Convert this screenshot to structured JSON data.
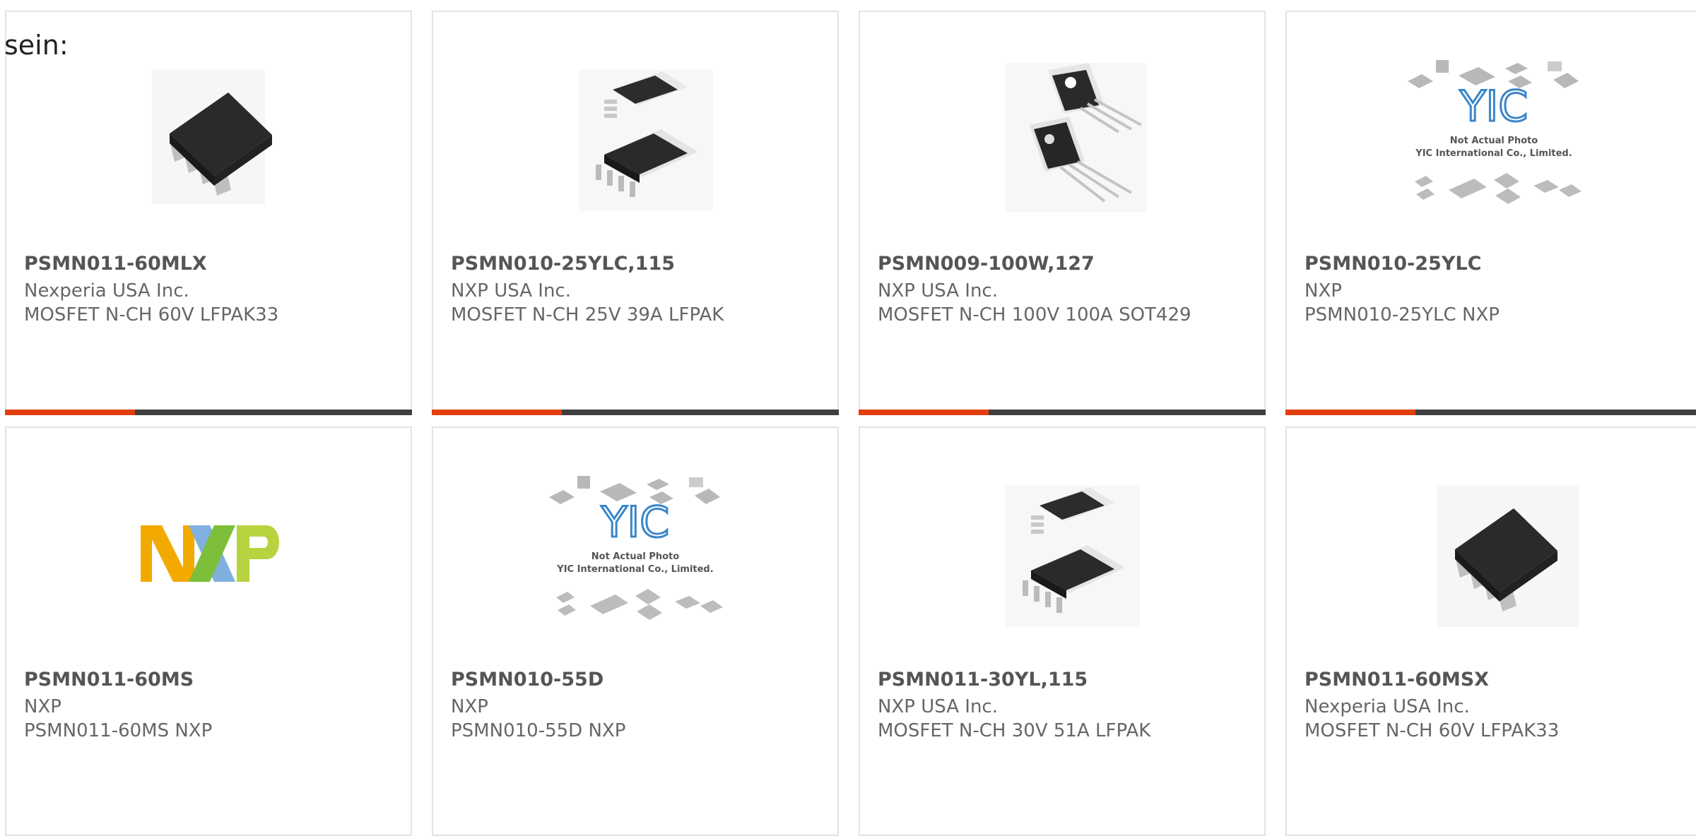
{
  "page": {
    "heading": "sein:"
  },
  "theme": {
    "accent_color": "#e23e0e",
    "bar_color": "#3f3f3f",
    "border_color": "#e3e3e3"
  },
  "products": [
    {
      "part_number": "PSMN011-60MLX",
      "manufacturer": "Nexperia USA Inc.",
      "description": "MOSFET N-CH 60V LFPAK33",
      "image": "lfpak33-package"
    },
    {
      "part_number": "PSMN010-25YLC,115",
      "manufacturer": "NXP USA Inc.",
      "description": "MOSFET N-CH 25V 39A LFPAK",
      "image": "lfpak-package"
    },
    {
      "part_number": "PSMN009-100W,127",
      "manufacturer": "NXP USA Inc.",
      "description": "MOSFET N-CH 100V 100A SOT429",
      "image": "to247-package"
    },
    {
      "part_number": "PSMN010-25YLC",
      "manufacturer": "NXP",
      "description": "PSMN010-25YLC NXP",
      "image": "yic-placeholder",
      "placeholder_line1": "Not Actual Photo",
      "placeholder_line2": "YIC International Co., Limited."
    },
    {
      "part_number": "PSMN011-60MS",
      "manufacturer": "NXP",
      "description": "PSMN011-60MS NXP",
      "image": "nxp-logo",
      "logo_text": "NXP"
    },
    {
      "part_number": "PSMN010-55D",
      "manufacturer": "NXP",
      "description": "PSMN010-55D NXP",
      "image": "yic-placeholder",
      "placeholder_line1": "Not Actual Photo",
      "placeholder_line2": "YIC International Co., Limited."
    },
    {
      "part_number": "PSMN011-30YL,115",
      "manufacturer": "NXP USA Inc.",
      "description": "MOSFET N-CH 30V 51A LFPAK",
      "image": "lfpak-package"
    },
    {
      "part_number": "PSMN011-60MSX",
      "manufacturer": "Nexperia USA Inc.",
      "description": "MOSFET N-CH 60V LFPAK33",
      "image": "lfpak33-package"
    }
  ]
}
